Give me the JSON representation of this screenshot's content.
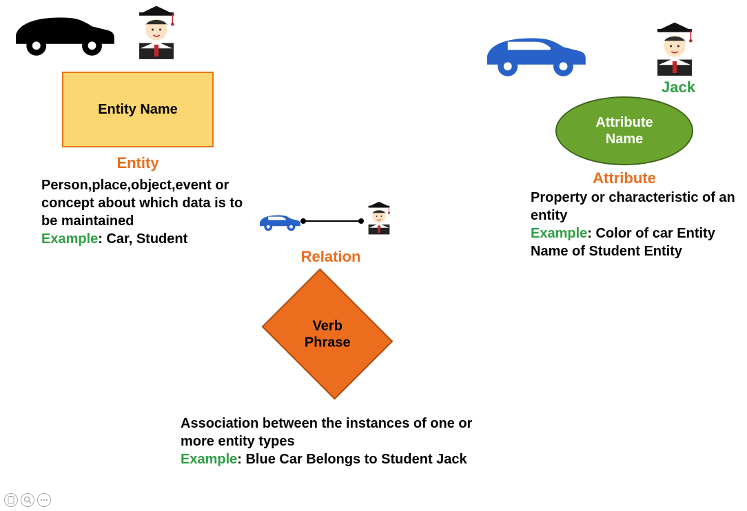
{
  "entity": {
    "shape_label": "Entity Name",
    "heading": "Entity",
    "desc": "Person,place,object,event or concept about which data is to be maintained",
    "example_label": "Example",
    "example_text": ": Car, Student"
  },
  "attribute": {
    "jack_name": "Jack",
    "shape_label": "Attribute\nName",
    "heading": "Attribute",
    "desc": "Property or characteristic of an entity",
    "example_label": "Example",
    "example_text": ": Color of car Entity Name of Student Entity"
  },
  "relation": {
    "heading": "Relation",
    "shape_label": "Verb\nPhrase",
    "desc": "Association between the instances of one or more entity types",
    "example_label": "Example",
    "example_text": ": Blue Car Belongs to Student Jack"
  },
  "icons": {
    "car_black": "car-icon",
    "car_blue": "car-icon",
    "student": "student-icon",
    "clipboard": "clipboard-icon",
    "magnifier": "magnifier-icon",
    "dots": "more-icon"
  },
  "colors": {
    "heading_orange": "#ec6d1e",
    "example_green": "#2f9e44",
    "entity_fill": "#fcd670",
    "attr_fill": "#6aa42f",
    "diamond_fill": "#ec6d1e",
    "car_blue": "#2861c7"
  }
}
